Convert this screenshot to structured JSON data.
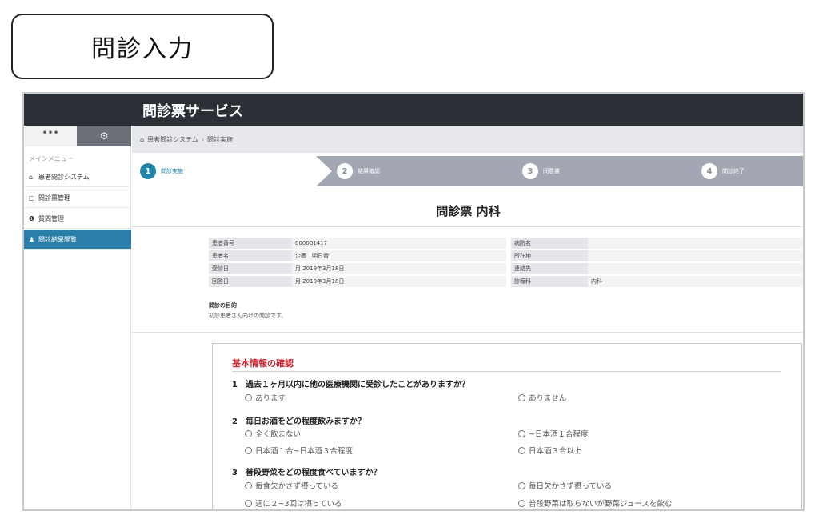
{
  "label": "問診入力",
  "app": {
    "title": "問診票サービス"
  },
  "sidebar": {
    "dots": "•••",
    "gear": "⚙",
    "caption": "メインメニュー",
    "items": [
      {
        "icon": "⌂",
        "label": "患者問診システム"
      },
      {
        "icon": "▢",
        "label": "問診票管理"
      },
      {
        "icon": "❶",
        "label": "質問管理"
      },
      {
        "icon": "♟",
        "label": "問診結果閲覧"
      }
    ]
  },
  "breadcrumb": {
    "home": "患者問診システム",
    "sep": "›",
    "current": "問診実施"
  },
  "steps": [
    {
      "num": "1",
      "label": "問診実施"
    },
    {
      "num": "2",
      "label": "結果確認"
    },
    {
      "num": "3",
      "label": "同意書"
    },
    {
      "num": "4",
      "label": "問診終了"
    }
  ],
  "form": {
    "title": "問診票 内科"
  },
  "info": {
    "rows": [
      [
        "患者番号",
        "000001417",
        "病院名",
        ""
      ],
      [
        "患者名",
        "企画　明日香",
        "所在地",
        ""
      ],
      [
        "受診日",
        "月 2019年3月18日",
        "連絡先",
        ""
      ],
      [
        "回答日",
        "月 2019年3月18日",
        "診療科",
        "内科"
      ]
    ]
  },
  "purpose": {
    "heading": "問診の目的",
    "text": "初診患者さん向けの問診です。"
  },
  "section": {
    "title": "基本情報の確認",
    "questions": [
      {
        "label": "1　過去１ヶ月以内に他の医療機関に受診したことがありますか？",
        "options": [
          "あります",
          "ありません"
        ]
      },
      {
        "label": "2　毎日お酒をどの程度飲みますか？",
        "options": [
          "全く飲まない",
          "~日本酒１合程度",
          "日本酒１合~日本酒３合程度",
          "日本酒３合以上"
        ]
      },
      {
        "label": "3　普段野菜をどの程度食べていますか？",
        "options": [
          "毎食欠かさず摂っている",
          "毎日欠かさず摂っている",
          "週に２~3回は摂っている",
          "普段野菜は取らないが野菜ジュースを飲む"
        ]
      }
    ]
  }
}
